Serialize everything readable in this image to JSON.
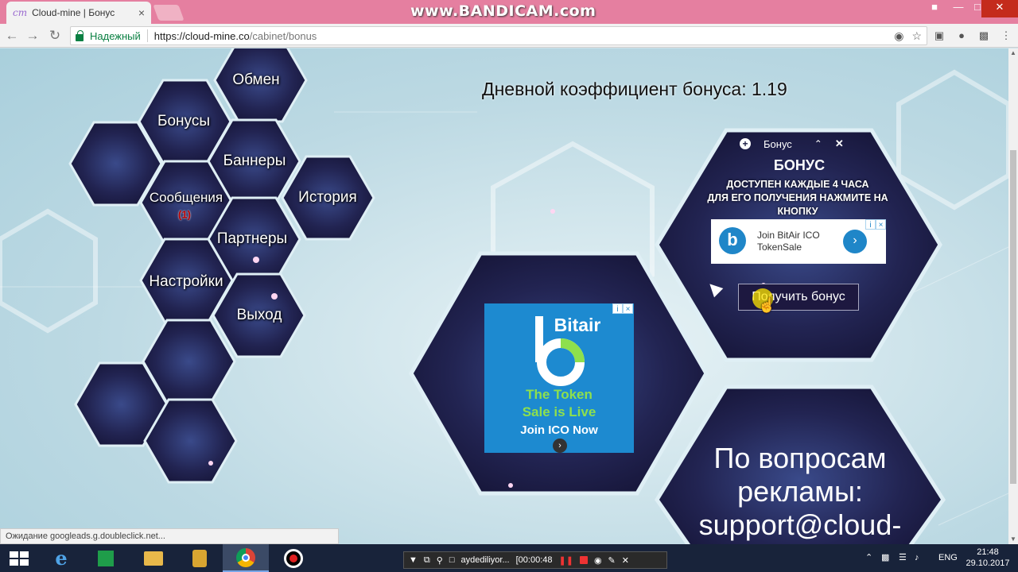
{
  "browser": {
    "tab_title": "Cloud-mine | Бонус",
    "tab_favicon": "cm",
    "tab_close": "×",
    "watermark": "www.BANDICAM.com",
    "secure_label": "Надежный",
    "url_host": "https://cloud-mine.co",
    "url_path": "/cabinet/bonus",
    "status_text": "Ожидание googleads.g.doubleclick.net..."
  },
  "nav_menu": {
    "exchange": "Обмен",
    "bonuses": "Бонусы",
    "banners": "Баннеры",
    "messages": "Сообщения",
    "messages_count": "(1)",
    "history": "История",
    "partners": "Партнеры",
    "settings": "Настройки",
    "logout": "Выход"
  },
  "main": {
    "coefficient_text": "Дневной коэффициент бонуса: 1.19"
  },
  "bonus_panel": {
    "header_label": "Бонус",
    "title": "БОНУС",
    "subtitle_line1": "ДОСТУПЕН КАЖДЫЕ 4 ЧАСА",
    "subtitle_line2": "ДЛЯ ЕГО ПОЛУЧЕНИЯ НАЖМИТЕ НА КНОПКУ",
    "button_label": "Получить бонус"
  },
  "ad_small": {
    "line1": "Join BitAir ICO",
    "line2": "TokenSale"
  },
  "ad_big": {
    "brand": "Bitair",
    "line1": "The Token",
    "line2": "Sale is Live",
    "cta": "Join ICO Now"
  },
  "support": {
    "line1": "По вопросам",
    "line2": "рекламы:",
    "line3": "support@cloud-"
  },
  "taskbar": {
    "bandicam_file": "aydediliyor...",
    "bandicam_time": "[00:00:48",
    "lang": "ENG",
    "time": "21:48",
    "date": "29.10.2017"
  },
  "colors": {
    "titlebar": "#e57fa0",
    "secure_green": "#0b8043",
    "ad_blue": "#1d8ad0",
    "hex_dark": "#1a1c44"
  }
}
